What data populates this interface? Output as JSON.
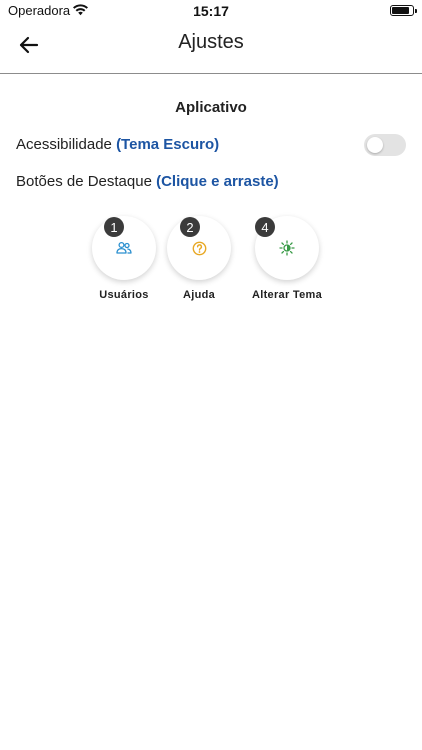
{
  "status_bar": {
    "carrier": "Operadora",
    "time": "15:17"
  },
  "header": {
    "title": "Ajustes",
    "back_icon": "arrow-left-icon"
  },
  "section": {
    "title": "Aplicativo"
  },
  "settings": {
    "accessibility": {
      "label": "Acessibilidade",
      "hint": "(Tema Escuro)",
      "toggle_on": false
    },
    "highlight_buttons": {
      "label": "Botões de Destaque",
      "hint": "(Clique e arraste)"
    }
  },
  "shortcuts": [
    {
      "number": "1",
      "label": "Usuários",
      "icon": "users-icon",
      "color": "#2a8fcf"
    },
    {
      "number": "2",
      "label": "Ajuda",
      "icon": "help-circle-icon",
      "color": "#e8a824"
    },
    {
      "number": "4",
      "label": "Alterar Tema",
      "icon": "theme-toggle-icon",
      "color": "#3a9b48"
    }
  ],
  "colors": {
    "accent": "#1d55a3",
    "badge": "#3b3b3b",
    "divider": "#8c8c8c"
  }
}
